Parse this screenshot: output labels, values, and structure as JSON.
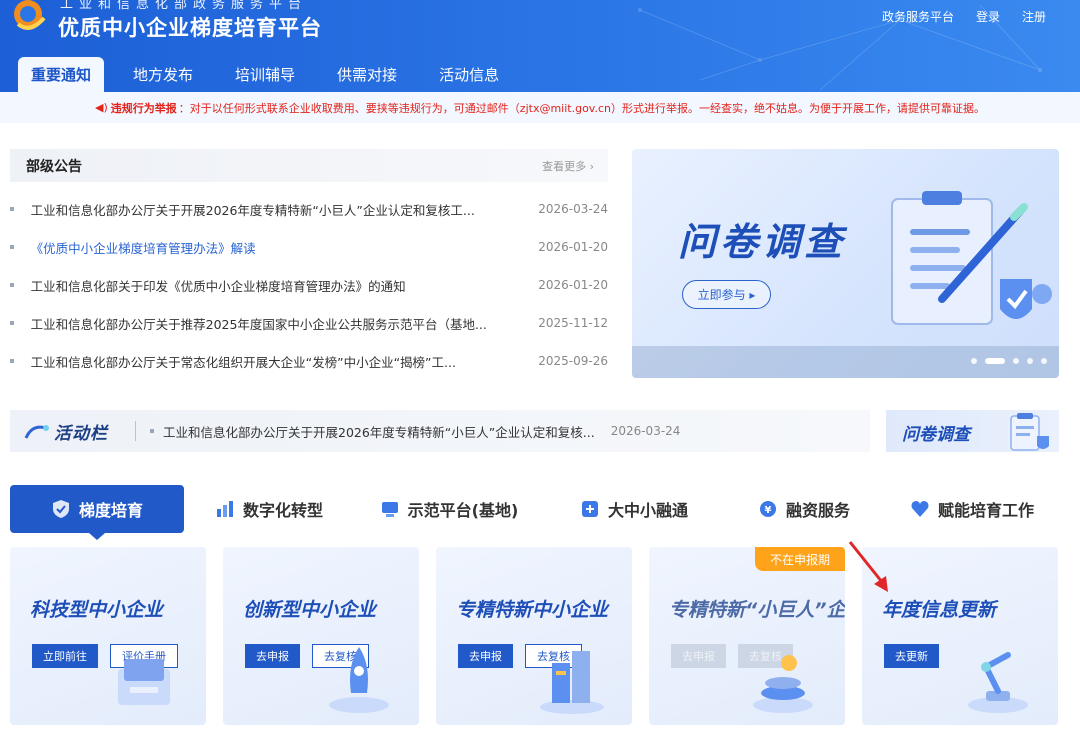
{
  "header": {
    "sub_title": "工业和信息化部政务服务平台",
    "site_title": "优质中小企业梯度培育平台",
    "links": [
      "政务服务平台",
      "登录",
      "注册"
    ],
    "tabs": [
      "重要通知",
      "地方发布",
      "培训辅导",
      "供需对接",
      "活动信息"
    ],
    "active_tab": "重要通知"
  },
  "notice": {
    "label": "违规行为举报",
    "text": "：对于以任何形式联系企业收取费用、要挟等违规行为，可通过邮件（zjtx@miit.gov.cn）形式进行举报。一经查实，绝不姑息。为便于开展工作，请提供可靠证据。",
    "color": "#e2231a"
  },
  "announcements": {
    "title": "部级公告",
    "more": "查看更多",
    "items": [
      {
        "text": "工业和信息化部办公厅关于开展2026年度专精特新“小巨人”企业认定和复核工...",
        "date": "2026-03-24"
      },
      {
        "text": "《优质中小企业梯度培育管理办法》解读",
        "date": "2026-01-20"
      },
      {
        "text": "工业和信息化部关于印发《优质中小企业梯度培育管理办法》的通知",
        "date": "2026-01-20"
      },
      {
        "text": "工业和信息化部办公厅关于推荐2025年度国家中小企业公共服务示范平台（基地...",
        "date": "2025-11-12"
      },
      {
        "text": "工业和信息化部办公厅关于常态化组织开展大企业“发榜”中小企业“揭榜”工...",
        "date": "2025-09-26"
      }
    ]
  },
  "banner": {
    "title": "问卷调查",
    "button": "立即参与",
    "slide_count": 5,
    "active_slide": 2
  },
  "activity": {
    "title": "活动栏",
    "item_text": "工业和信息化部办公厅关于开展2026年度专精特新“小巨人”企业认定和复核...",
    "item_date": "2026-03-24",
    "side_card": "问卷调查"
  },
  "categories": {
    "items": [
      "梯度培育",
      "数字化转型",
      "示范平台(基地)",
      "大中小融通",
      "融资服务",
      "赋能培育工作"
    ],
    "active": "梯度培育"
  },
  "cards": [
    {
      "title": "科技型中小企业",
      "buttons": [
        "立即前往",
        "评价手册"
      ]
    },
    {
      "title": "创新型中小企业",
      "buttons": [
        "去申报",
        "去复核"
      ]
    },
    {
      "title": "专精特新中小企业",
      "buttons": [
        "去申报",
        "去复核"
      ]
    },
    {
      "title": "专精特新“小巨人”企业",
      "buttons": [
        "去申报",
        "去复核"
      ],
      "badge": "不在申报期"
    },
    {
      "title": "年度信息更新",
      "buttons": [
        "去更新"
      ]
    }
  ],
  "colors": {
    "primary": "#2259c8",
    "header": "#2b76e6",
    "badge": "#ffa31a",
    "arrow": "#e02727"
  }
}
